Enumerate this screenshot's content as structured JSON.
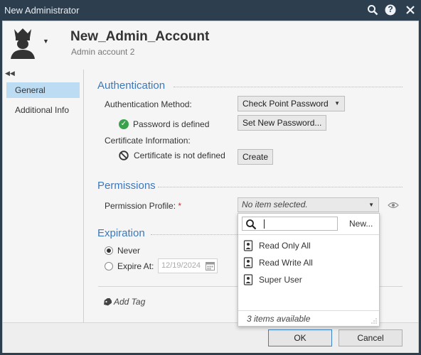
{
  "window": {
    "title": "New Administrator",
    "icons": [
      "search-icon",
      "help-icon",
      "close-icon"
    ],
    "help_glyph": "?"
  },
  "header": {
    "name": "New_Admin_Account",
    "comment": "Admin account 2",
    "avatar_icon": "admin-crown-icon"
  },
  "nav": {
    "items": [
      {
        "label": "General",
        "active": true
      },
      {
        "label": "Additional Info",
        "active": false
      }
    ]
  },
  "authentication": {
    "title": "Authentication",
    "method_label": "Authentication Method:",
    "method_value": "Check Point Password",
    "password_status": "Password is defined",
    "set_password_button": "Set New Password...",
    "certificate_label": "Certificate Information:",
    "certificate_status": "Certificate is not defined",
    "create_button": "Create"
  },
  "permissions": {
    "title": "Permissions",
    "profile_label": "Permission Profile:",
    "required_mark": "*",
    "profile_value": "No item selected."
  },
  "expiration": {
    "title": "Expiration",
    "never_label": "Never",
    "expire_label": "Expire At:",
    "expire_date": "12/19/2024",
    "selected": "never"
  },
  "tags": {
    "add_label": "Add Tag"
  },
  "dropdown": {
    "search_value": "",
    "new_label": "New...",
    "items": [
      {
        "label": "Read Only All"
      },
      {
        "label": "Read Write All"
      },
      {
        "label": "Super User"
      }
    ],
    "count_text": "3 items available"
  },
  "footer": {
    "ok_label": "OK",
    "cancel_label": "Cancel"
  },
  "colors": {
    "titlebar": "#2d3e4f",
    "section_title": "#3a78bd",
    "nav_active": "#bcdcf4",
    "success": "#3aa24c",
    "required": "#d12b2b"
  }
}
